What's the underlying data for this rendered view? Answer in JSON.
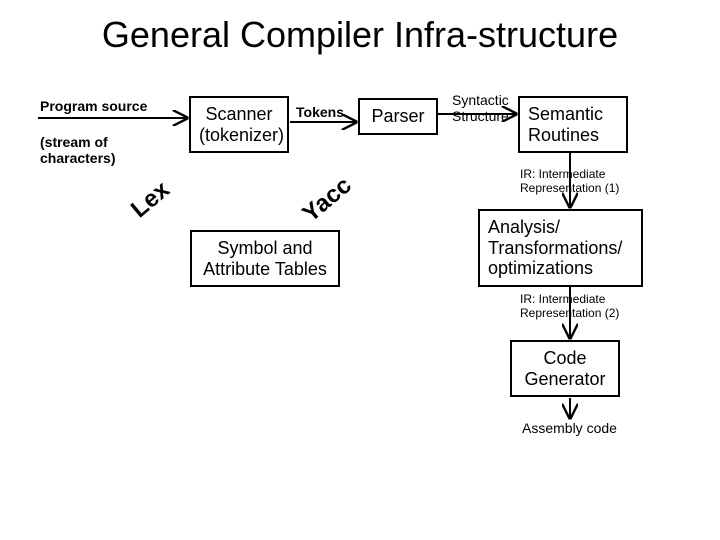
{
  "title": "General Compiler Infra-structure",
  "labels": {
    "program_source": "Program source",
    "stream": "(stream of\ncharacters)",
    "tokens": "Tokens",
    "syntactic": "Syntactic\nStructure",
    "ir1": "IR: Intermediate\nRepresentation (1)",
    "ir2": "IR: Intermediate\nRepresentation (2)",
    "assembly": "Assembly code",
    "lex": "Lex",
    "yacc": "Yacc"
  },
  "boxes": {
    "scanner": "Scanner\n(tokenizer)",
    "parser": "Parser",
    "semantic": "Semantic\nRoutines",
    "analysis": "Analysis/\nTransformations/\noptimizations",
    "symbol": "Symbol and\nAttribute Tables",
    "codegen": "Code\nGenerator"
  }
}
